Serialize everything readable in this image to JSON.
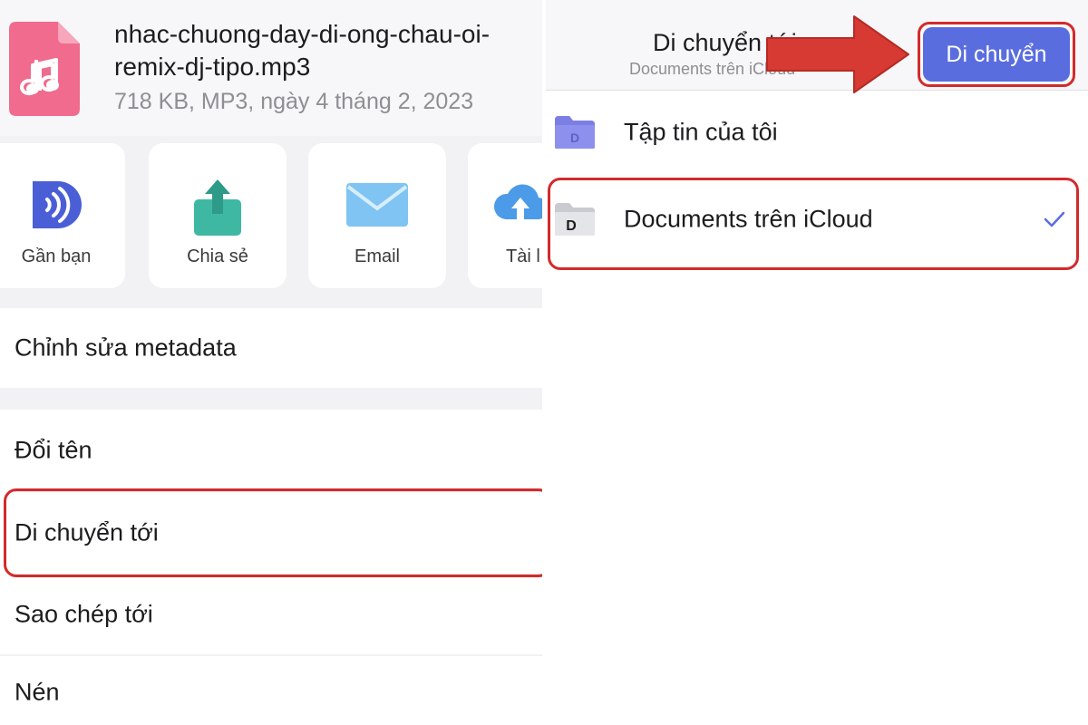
{
  "left": {
    "file": {
      "name_line1": "nhac-chuong-day-di-ong-chau-oi-",
      "name_line2": "remix-dj-tipo.mp3",
      "meta": "718 KB, MP3, ngày 4 tháng 2, 2023",
      "icon": "music-file-icon"
    },
    "actions": [
      {
        "label": "Gần bạn",
        "icon": "nearby-share-icon"
      },
      {
        "label": "Chia sẻ",
        "icon": "share-icon"
      },
      {
        "label": "Email",
        "icon": "email-icon"
      },
      {
        "label": "Tài l",
        "icon": "cloud-upload-icon"
      }
    ],
    "menu": {
      "edit_metadata": "Chỉnh sửa metadata",
      "rename": "Đổi tên",
      "move_to": "Di chuyển tới",
      "copy_to": "Sao chép tới",
      "compress": "Nén"
    }
  },
  "right": {
    "header": {
      "title": "Di chuyển tới",
      "subtitle": "Documents trên iCloud",
      "move_button": "Di chuyển"
    },
    "folders": [
      {
        "label": "Tập tin của tôi",
        "icon": "my-files-folder-icon",
        "selected": false
      },
      {
        "label": "Documents trên iCloud",
        "icon": "documents-icloud-folder-icon",
        "selected": true
      }
    ]
  },
  "colors": {
    "accent": "#5a6ddf",
    "highlight": "#d42a2a",
    "file_icon": "#f06b8d",
    "checkmark": "#5a6ddf"
  }
}
